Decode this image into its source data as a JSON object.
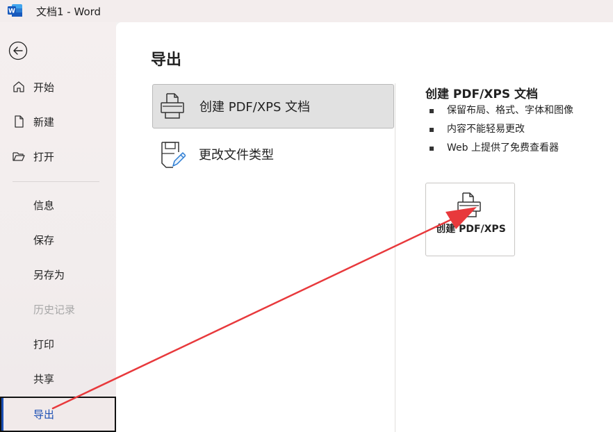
{
  "window": {
    "title": "文档1  -  Word",
    "app_icon": "word-icon"
  },
  "sidebar": {
    "back_icon": "back-arrow-icon",
    "items": [
      {
        "label": "开始",
        "icon": "home-icon",
        "state": "normal"
      },
      {
        "label": "新建",
        "icon": "new-document-icon",
        "state": "normal"
      },
      {
        "label": "打开",
        "icon": "open-folder-icon",
        "state": "normal"
      },
      {
        "label": "信息",
        "state": "normal"
      },
      {
        "label": "保存",
        "state": "normal"
      },
      {
        "label": "另存为",
        "state": "normal"
      },
      {
        "label": "历史记录",
        "state": "disabled"
      },
      {
        "label": "打印",
        "state": "normal"
      },
      {
        "label": "共享",
        "state": "normal"
      },
      {
        "label": "导出",
        "state": "active"
      }
    ]
  },
  "main": {
    "title": "导出",
    "options": [
      {
        "label": "创建 PDF/XPS 文档",
        "icon": "pdf-xps-document-icon",
        "selected": true
      },
      {
        "label": "更改文件类型",
        "icon": "change-file-type-icon",
        "selected": false
      }
    ],
    "detail": {
      "title": "创建 PDF/XPS 文档",
      "bullets": [
        "保留布局、格式、字体和图像",
        "内容不能轻易更改",
        "Web 上提供了免费查看器"
      ],
      "button_label": "创建 PDF/XPS",
      "button_icon": "pdf-xps-create-icon"
    }
  },
  "annotation": {
    "type": "arrow",
    "color": "#e8393c"
  },
  "colors": {
    "accent": "#1b4fb4",
    "word_blue": "#185abd",
    "selected_bg": "#e1e1e1"
  }
}
